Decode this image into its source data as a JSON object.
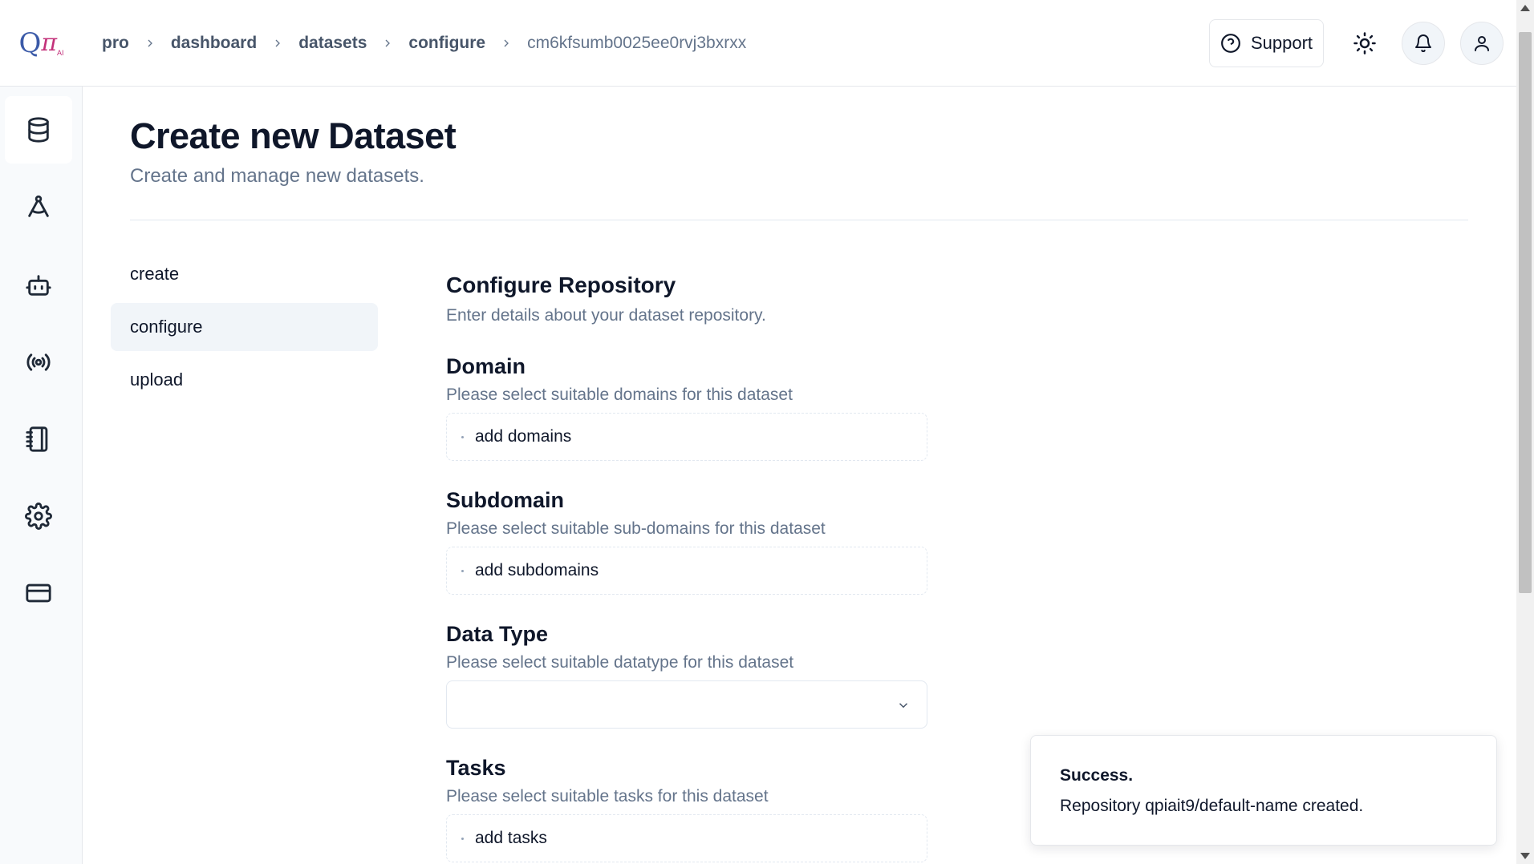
{
  "breadcrumb": [
    "pro",
    "dashboard",
    "datasets",
    "configure",
    "cm6kfsumb0025ee0rvj3bxrxx"
  ],
  "topbar": {
    "support_label": "Support"
  },
  "logo": {
    "q": "Q",
    "pi": "π",
    "ai": "AI"
  },
  "rail": {
    "items": [
      "database-icon",
      "compass-icon",
      "bot-icon",
      "radio-icon",
      "notebook-icon",
      "settings-icon",
      "credit-card-icon"
    ],
    "active": "database-icon"
  },
  "page": {
    "title": "Create new Dataset",
    "subtitle": "Create and manage new datasets."
  },
  "subnav": {
    "items": [
      "create",
      "configure",
      "upload"
    ],
    "active": "configure"
  },
  "form": {
    "title": "Configure Repository",
    "description": "Enter details about your dataset repository.",
    "domain": {
      "label": "Domain",
      "description": "Please select suitable domains for this dataset",
      "placeholder": "add domains"
    },
    "subdomain": {
      "label": "Subdomain",
      "description": "Please select suitable sub-domains for this dataset",
      "placeholder": "add subdomains"
    },
    "datatype": {
      "label": "Data Type",
      "description": "Please select suitable datatype for this dataset",
      "value": ""
    },
    "tasks": {
      "label": "Tasks",
      "description": "Please select suitable tasks for this dataset",
      "placeholder": "add tasks"
    }
  },
  "toast": {
    "title": "Success.",
    "message": "Repository qpiait9/default-name created."
  },
  "colors": {
    "logo_blue": "#3b5aa8",
    "logo_magenta": "#c3317a",
    "muted_text": "#64748b",
    "active_bg": "#f1f5f9"
  }
}
